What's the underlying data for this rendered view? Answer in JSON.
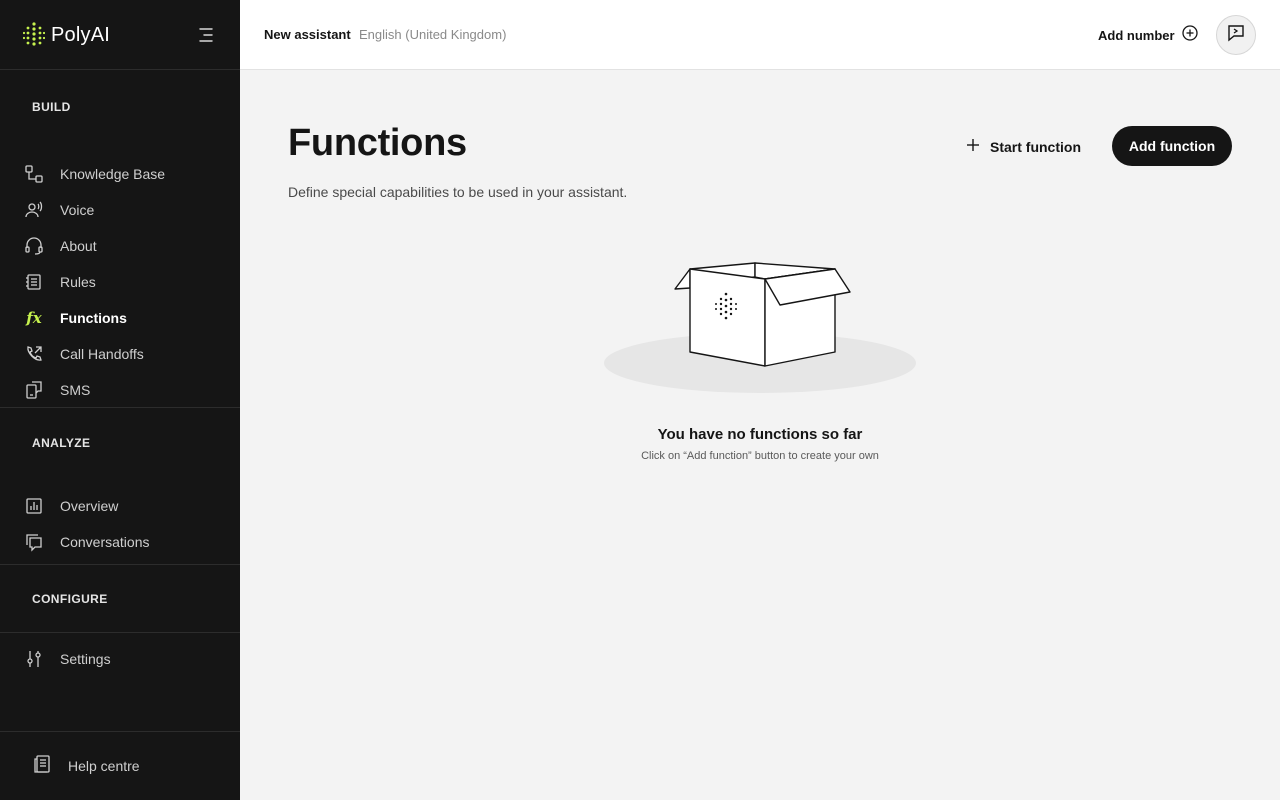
{
  "app": {
    "logo_text": "PolyAI",
    "accent_color": "#c6f24e"
  },
  "sidebar": {
    "sections": [
      {
        "title": "BUILD",
        "items": [
          {
            "label": "Knowledge Base",
            "icon": "knowledge-base-icon"
          },
          {
            "label": "Voice",
            "icon": "voice-icon"
          },
          {
            "label": "About",
            "icon": "headset-icon"
          },
          {
            "label": "Rules",
            "icon": "rules-icon"
          },
          {
            "label": "Functions",
            "icon": "function-icon",
            "active": true
          },
          {
            "label": "Call Handoffs",
            "icon": "call-handoff-icon"
          },
          {
            "label": "SMS",
            "icon": "sms-icon"
          }
        ]
      },
      {
        "title": "ANALYZE",
        "items": [
          {
            "label": "Overview",
            "icon": "chart-icon"
          },
          {
            "label": "Conversations",
            "icon": "conversations-icon"
          }
        ]
      },
      {
        "title": "CONFIGURE",
        "items": [
          {
            "label": "Settings",
            "icon": "sliders-icon"
          }
        ]
      }
    ],
    "help_label": "Help centre"
  },
  "topbar": {
    "assistant_name": "New assistant",
    "language": "English (United Kingdom)",
    "add_number_label": "Add number"
  },
  "main": {
    "title": "Functions",
    "description": "Define special capabilities to be used in your assistant.",
    "start_function_label": "Start function",
    "add_function_label": "Add function",
    "empty_title": "You have no functions so far",
    "empty_subtitle": "Click on “Add function” button to create your own"
  }
}
